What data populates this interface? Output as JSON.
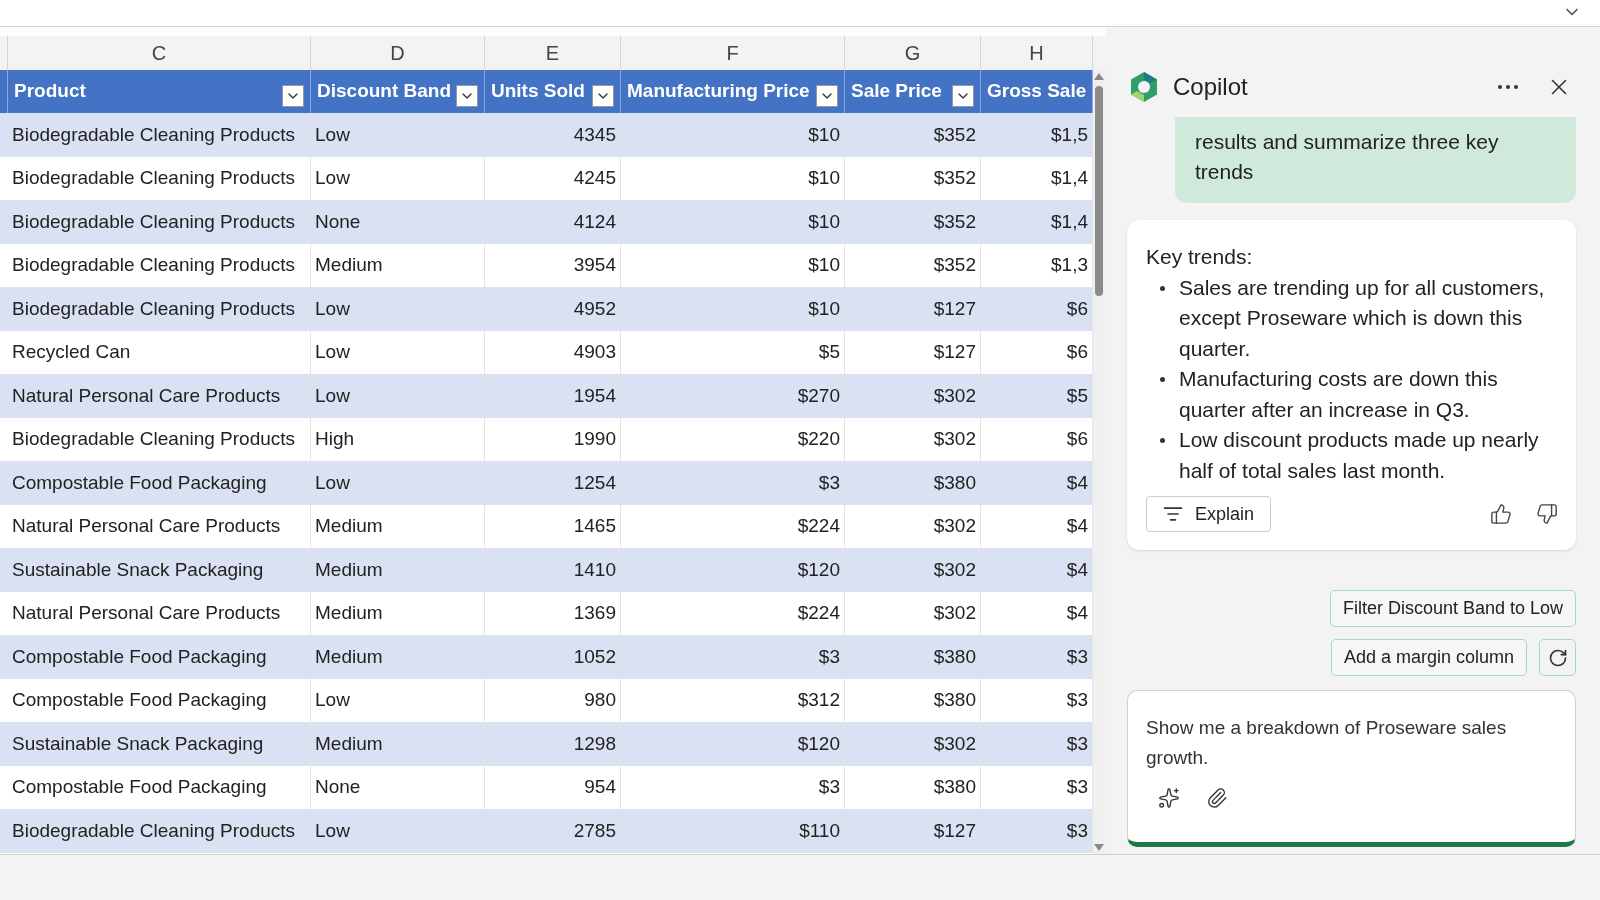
{
  "sheet": {
    "column_letters": [
      "C",
      "D",
      "E",
      "F",
      "G",
      "H"
    ],
    "headers": [
      {
        "label": "Product",
        "filter": true
      },
      {
        "label": "Discount Band",
        "filter": true
      },
      {
        "label": "Units Sold",
        "filter": true
      },
      {
        "label": "Manufacturing Price",
        "filter": true
      },
      {
        "label": "Sale Price",
        "filter": true
      },
      {
        "label": "Gross Sale",
        "filter": false
      }
    ],
    "rows": [
      [
        "Biodegradable Cleaning Products",
        "Low",
        "4345",
        "$10",
        "$352",
        "$1,5"
      ],
      [
        "Biodegradable Cleaning Products",
        "Low",
        "4245",
        "$10",
        "$352",
        "$1,4"
      ],
      [
        "Biodegradable Cleaning Products",
        "None",
        "4124",
        "$10",
        "$352",
        "$1,4"
      ],
      [
        "Biodegradable Cleaning Products",
        "Medium",
        "3954",
        "$10",
        "$352",
        "$1,3"
      ],
      [
        "Biodegradable Cleaning Products",
        "Low",
        "4952",
        "$10",
        "$127",
        "$6"
      ],
      [
        "Recycled Can",
        "Low",
        "4903",
        "$5",
        "$127",
        "$6"
      ],
      [
        "Natural Personal Care Products",
        "Low",
        "1954",
        "$270",
        "$302",
        "$5"
      ],
      [
        "Biodegradable Cleaning Products",
        "High",
        "1990",
        "$220",
        "$302",
        "$6"
      ],
      [
        "Compostable Food Packaging",
        "Low",
        "1254",
        "$3",
        "$380",
        "$4"
      ],
      [
        "Natural Personal Care Products",
        "Medium",
        "1465",
        "$224",
        "$302",
        "$4"
      ],
      [
        "Sustainable Snack Packaging",
        "Medium",
        "1410",
        "$120",
        "$302",
        "$4"
      ],
      [
        "Natural Personal Care Products",
        "Medium",
        "1369",
        "$224",
        "$302",
        "$4"
      ],
      [
        "Compostable Food Packaging",
        "Medium",
        "1052",
        "$3",
        "$380",
        "$3"
      ],
      [
        "Compostable Food Packaging",
        "Low",
        "980",
        "$312",
        "$380",
        "$3"
      ],
      [
        "Sustainable Snack Packaging",
        "Medium",
        "1298",
        "$120",
        "$302",
        "$3"
      ],
      [
        "Compostable Food Packaging",
        "None",
        "954",
        "$3",
        "$380",
        "$3"
      ],
      [
        "Biodegradable Cleaning Products",
        "Low",
        "2785",
        "$110",
        "$127",
        "$3"
      ]
    ]
  },
  "copilot": {
    "title": "Copilot",
    "user_message": "results and summarize three key trends",
    "response": {
      "heading": "Key trends:",
      "bullets": [
        "Sales are trending up for all customers, except Proseware which is down this quarter.",
        "Manufacturing costs are down this quarter after an increase in Q3.",
        "Low discount products made up nearly half of total sales last month."
      ],
      "action": "Explain"
    },
    "suggestions": [
      "Filter Discount Band to Low",
      "Add a margin column"
    ],
    "input": {
      "value": "Show me a breakdown of Proseware sales growth."
    }
  }
}
